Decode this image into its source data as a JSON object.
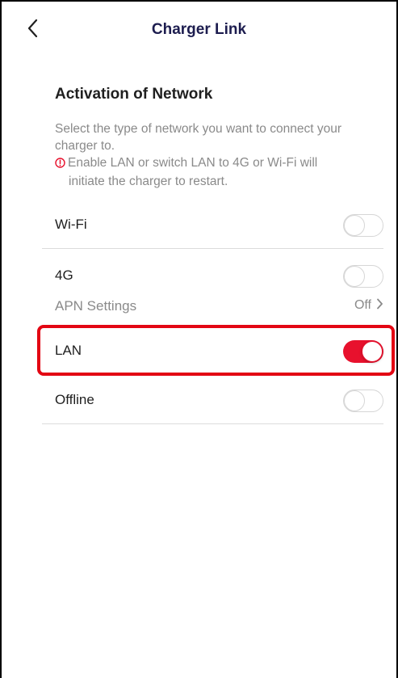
{
  "header": {
    "title": "Charger Link",
    "back_icon": "chevron-left-icon"
  },
  "section": {
    "title": "Activation of Network",
    "description": "Select the type of network you want to connect your charger to.",
    "note_line1": "Enable LAN or switch LAN to 4G or Wi-Fi will",
    "note_line2": "initiate the charger to restart.",
    "note_icon": "warning-circle-icon"
  },
  "rows": {
    "wifi": {
      "label": "Wi-Fi",
      "enabled": false
    },
    "g4": {
      "label": "4G",
      "enabled": false
    },
    "apn": {
      "label": "APN Settings",
      "value": "Off"
    },
    "lan": {
      "label": "LAN",
      "enabled": true
    },
    "offline": {
      "label": "Offline",
      "enabled": false
    }
  },
  "colors": {
    "accent": "#e8112d",
    "highlight": "#e30613",
    "title": "#1d1d4f",
    "muted": "#8a8a8a"
  }
}
